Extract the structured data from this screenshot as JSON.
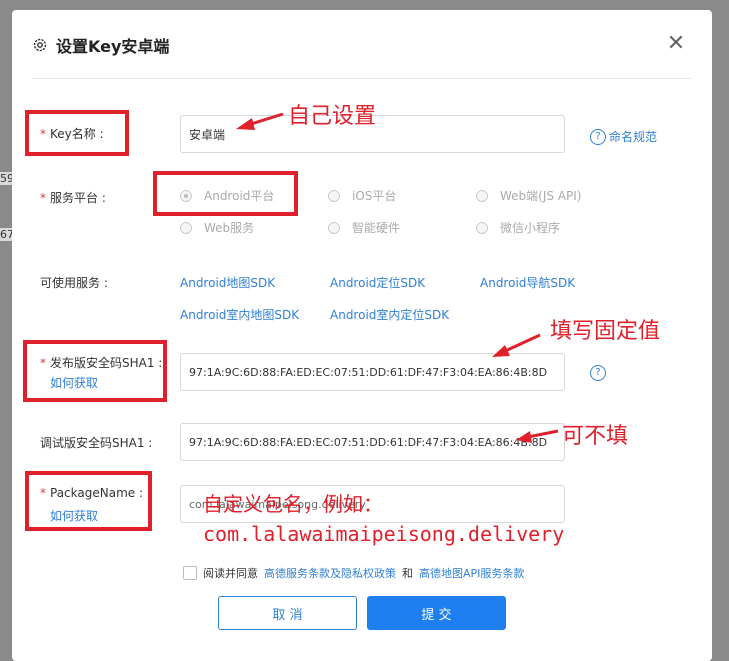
{
  "background": {
    "fragment1": "59",
    "fragment2": "67"
  },
  "dialog": {
    "title": "设置Key安卓端",
    "close": "✕",
    "key_name": {
      "label": "Key名称 :",
      "value": "安卓端",
      "help_link": "命名规范"
    },
    "platform": {
      "label": "服务平台 :",
      "options": [
        "Android平台",
        "iOS平台",
        "Web端(JS API)",
        "Web服务",
        "智能硬件",
        "微信小程序"
      ],
      "selected": "Android平台"
    },
    "services": {
      "label": "可使用服务 :",
      "items": [
        "Android地图SDK",
        "Android定位SDK",
        "Android导航SDK",
        "Android室内地图SDK",
        "Android室内定位SDK"
      ]
    },
    "release_sha1": {
      "label": "发布版安全码SHA1 :",
      "how_to": "如何获取",
      "value": "97:1A:9C:6D:88:FA:ED:EC:07:51:DD:61:DF:47:F3:04:EA:86:4B:8D"
    },
    "debug_sha1": {
      "label": "调试版安全码SHA1 :",
      "value": "97:1A:9C:6D:88:FA:ED:EC:07:51:DD:61:DF:47:F3:04:EA:86:4B:8D"
    },
    "package_name": {
      "label": "PackageName :",
      "how_to": "如何获取",
      "value": "com.lalawaimaipeisong.delivery"
    },
    "agreement": {
      "prefix": "阅读并同意",
      "link1": "高德服务条款及隐私权政策",
      "and": "和",
      "link2": "高德地图API服务条款"
    },
    "buttons": {
      "cancel": "取 消",
      "submit": "提 交"
    }
  },
  "annotations": {
    "key_name": "自己设置",
    "release_sha1": "填写固定值",
    "debug_sha1": "可不填",
    "package_line1": "自定义包名，例如：",
    "package_line2": "com.lalawaimaipeisong.delivery"
  },
  "colors": {
    "annotation_red": "#e0202a",
    "link_blue": "#2f7fd6",
    "submit_blue": "#1e7ff0",
    "required_red": "#e03b3b"
  }
}
